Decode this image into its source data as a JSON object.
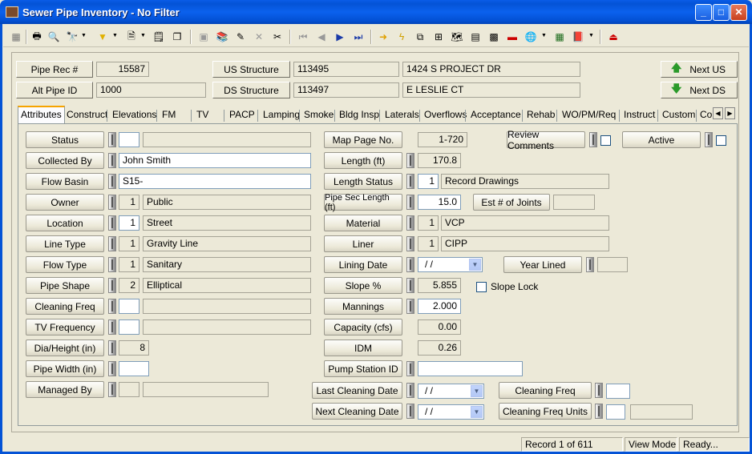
{
  "window": {
    "title": "Sewer Pipe Inventory - No Filter",
    "min": "_",
    "max": "□",
    "close": "✕"
  },
  "header": {
    "pipe_rec_label": "Pipe Rec #",
    "pipe_rec_value": "15587",
    "alt_pipe_label": "Alt Pipe ID",
    "alt_pipe_value": "1000",
    "us_structure_label": "US Structure",
    "us_structure_value": "113495",
    "us_address": "1424  S  PROJECT DR",
    "ds_structure_label": "DS Structure",
    "ds_structure_value": "113497",
    "ds_address": "E  LESLIE CT",
    "next_us_label": "Next US",
    "next_ds_label": "Next DS"
  },
  "tabs": [
    "Attributes",
    "Construct",
    "Elevations",
    "FM",
    "TV",
    "PACP",
    "Lamping",
    "Smoke",
    "Bldg Insp",
    "Laterals",
    "Overflows",
    "Acceptance",
    "Rehab",
    "WO/PM/Req",
    "Instruct",
    "Custom",
    "Co"
  ],
  "left": {
    "status": {
      "label": "Status",
      "code": "",
      "text": ""
    },
    "collected_by": {
      "label": "Collected By",
      "value": "John Smith"
    },
    "flow_basin": {
      "label": "Flow Basin",
      "value": "S15-"
    },
    "owner": {
      "label": "Owner",
      "code": "1",
      "text": "Public"
    },
    "location": {
      "label": "Location",
      "code": "1",
      "text": "Street"
    },
    "line_type": {
      "label": "Line Type",
      "code": "1",
      "text": "Gravity Line"
    },
    "flow_type": {
      "label": "Flow Type",
      "code": "1",
      "text": "Sanitary"
    },
    "pipe_shape": {
      "label": "Pipe Shape",
      "code": "2",
      "text": "Elliptical"
    },
    "cleaning_freq": {
      "label": "Cleaning Freq",
      "code": "",
      "text": ""
    },
    "tv_frequency": {
      "label": "TV Frequency",
      "code": "",
      "text": ""
    },
    "dia_height": {
      "label": "Dia/Height (in)",
      "value": "8"
    },
    "pipe_width": {
      "label": "Pipe Width (in)",
      "value": ""
    },
    "managed_by": {
      "label": "Managed By",
      "code": "",
      "text": ""
    }
  },
  "middle": {
    "map_page": {
      "label": "Map Page No.",
      "value": "1-720"
    },
    "length": {
      "label": "Length (ft)",
      "value": "170.8"
    },
    "length_status": {
      "label": "Length Status",
      "code": "1",
      "text": "Record Drawings"
    },
    "pipe_sec_length": {
      "label": "Pipe Sec Length (ft)",
      "value": "15.0"
    },
    "est_joints": {
      "label": "Est # of Joints",
      "value": ""
    },
    "material": {
      "label": "Material",
      "code": "1",
      "text": "VCP"
    },
    "liner": {
      "label": "Liner",
      "code": "1",
      "text": "CIPP"
    },
    "lining_date": {
      "label": "Lining Date",
      "value": " / /"
    },
    "year_lined": {
      "label": "Year Lined",
      "value": ""
    },
    "slope": {
      "label": "Slope %",
      "value": "5.855"
    },
    "slope_lock": {
      "label": "Slope Lock"
    },
    "mannings": {
      "label": "Mannings",
      "value": "2.000"
    },
    "capacity": {
      "label": "Capacity (cfs)",
      "value": "0.00"
    },
    "idm": {
      "label": "IDM",
      "value": "0.26"
    },
    "pump_station": {
      "label": "Pump Station ID",
      "value": ""
    },
    "last_cleaning": {
      "label": "Last Cleaning Date",
      "value": " / /"
    },
    "next_cleaning": {
      "label": "Next Cleaning Date",
      "value": " / /"
    },
    "cleaning_freq2": {
      "label": "Cleaning Freq",
      "value": ""
    },
    "cleaning_freq_units": {
      "label": "Cleaning Freq Units",
      "code": "",
      "text": ""
    }
  },
  "right": {
    "review_comments": "Review Comments",
    "active": "Active"
  },
  "statusbar": {
    "record": "Record 1 of 611",
    "mode": "View Mode",
    "state": "Ready..."
  }
}
